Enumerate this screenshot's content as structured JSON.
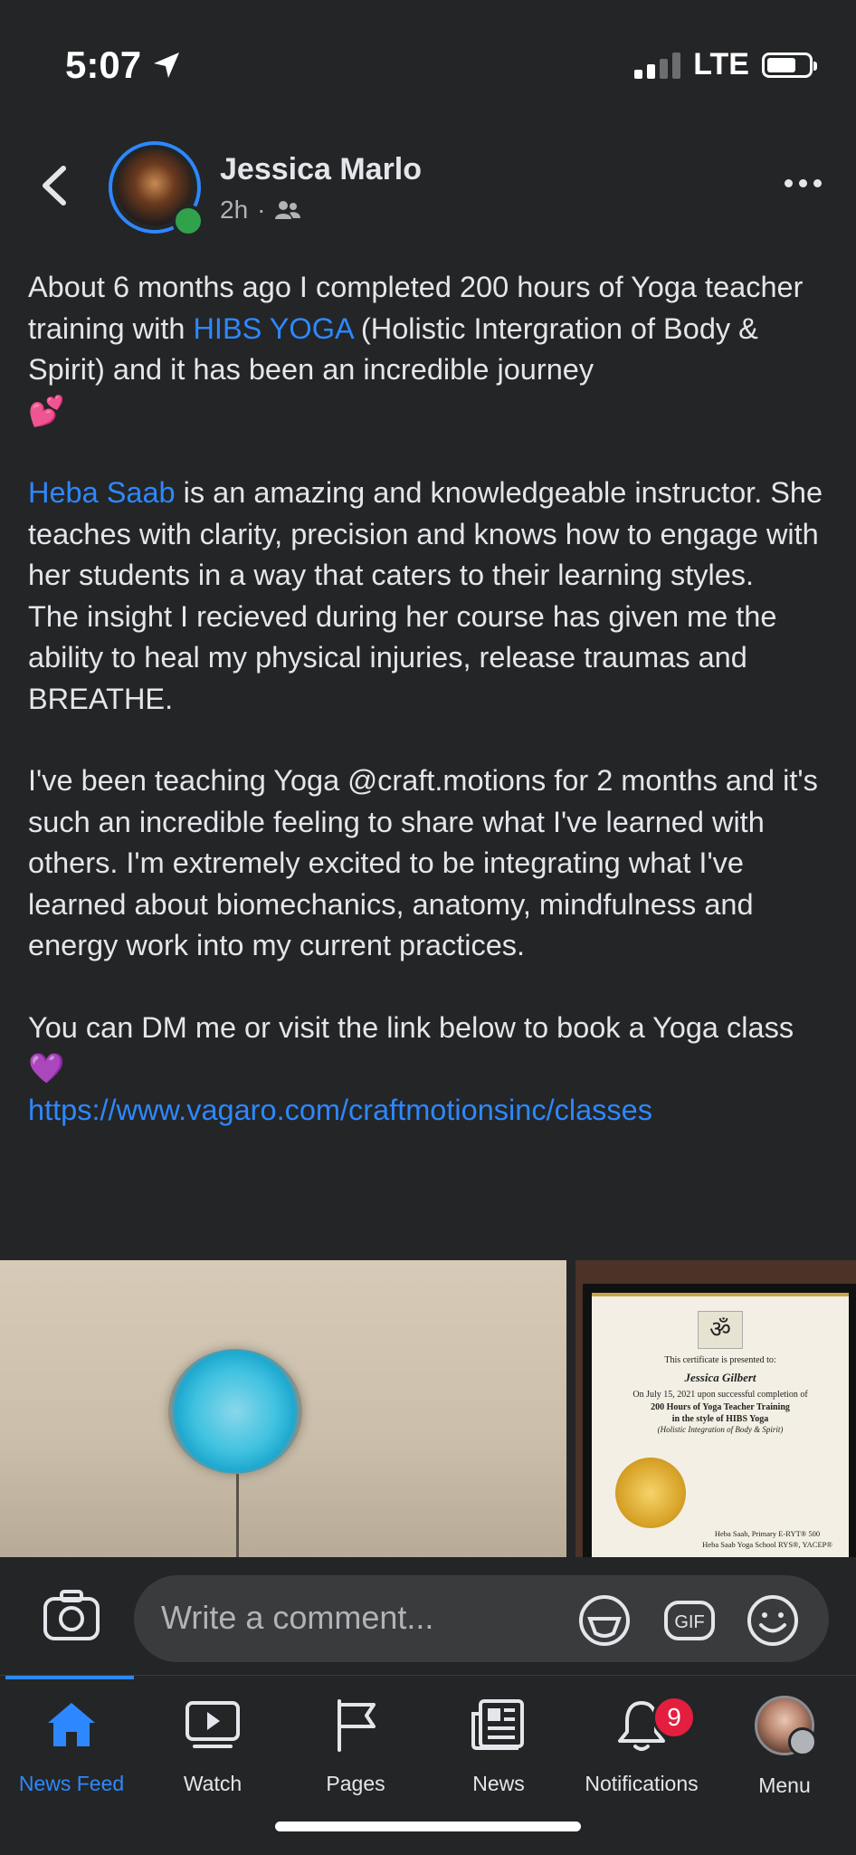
{
  "status_bar": {
    "time": "5:07",
    "network": "LTE"
  },
  "post": {
    "author": "Jessica Marlo",
    "time_ago": "2h",
    "separator": "·",
    "paragraphs": {
      "p1_part1": "About 6 months ago I completed 200 hours of Yoga teacher training with ",
      "p1_link": "HIBS YOGA",
      "p1_part2": "  (Holistic Intergration of Body & Spirit) and it has been an incredible journey",
      "p1_emoji": "💕",
      "p2_link": "Heba Saab",
      "p2_part1": "  is an amazing and knowledgeable instructor. She teaches with clarity, precision and knows how to engage with her students in a way that caters to their learning styles.",
      "p2_part2": "The insight I recieved during her course has given me the ability to heal my physical injuries, release traumas and BREATHE.",
      "p3": "I've been teaching Yoga @craft.motions for 2 months and it's such an incredible feeling to share what I've learned with others. I'm extremely excited to be integrating what I've learned about biomechanics, anatomy, mindfulness and energy work into my current practices.",
      "p4_part1": "You can DM me or visit the link below to book a Yoga class ",
      "p4_emoji": "💜",
      "url": "https://www.vagaro.com/craftmotionsinc/classes"
    }
  },
  "certificate": {
    "om": "ॐ",
    "presented": "This certificate is presented to:",
    "name": "Jessica Gilbert",
    "date_line": "On July 15, 2021 upon successful completion of",
    "course_1": "200 Hours of Yoga Teacher Training",
    "course_2": "in the style of HIBS Yoga",
    "course_3": "(Holistic Integration of Body & Spirit)",
    "sign_1": "Heba Saab, Primary E-RYT® 500",
    "sign_2": "Heba Saab Yoga School RYS®, YACEP®"
  },
  "comment_bar": {
    "placeholder": "Write a comment...",
    "gif_label": "GIF"
  },
  "tabs": [
    {
      "label": "News Feed",
      "icon": "home-icon"
    },
    {
      "label": "Watch",
      "icon": "watch-icon"
    },
    {
      "label": "Pages",
      "icon": "flag-icon"
    },
    {
      "label": "News",
      "icon": "news-icon"
    },
    {
      "label": "Notifications",
      "icon": "bell-icon",
      "badge": "9"
    },
    {
      "label": "Menu",
      "icon": "profile-avatar"
    }
  ],
  "colors": {
    "background": "#242526",
    "accent": "#2d88ff",
    "badge": "#e41e3f",
    "online": "#31a24c"
  }
}
